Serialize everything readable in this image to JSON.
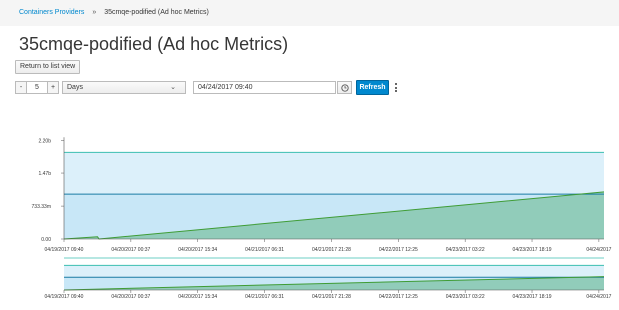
{
  "breadcrumb": {
    "parent": "Containers Providers",
    "separator": "»",
    "current": "35cmqe-podified (Ad hoc Metrics)"
  },
  "page": {
    "title": "35cmqe-podified (Ad hoc Metrics)"
  },
  "toolbar": {
    "return_label": "Return to list view",
    "stepper_minus": "-",
    "stepper_value": "5",
    "stepper_plus": "+",
    "unit_value": "Days",
    "date_value": "04/24/2017 09:40",
    "refresh_label": "Refresh",
    "clock_icon": "clock-icon",
    "kebab_icon": "kebab-icon",
    "chevron_icon": "chevron-down-icon"
  },
  "colors": {
    "accent": "#0088ce",
    "area_fill": "#bfe3f5",
    "upper_line": "#3dbfb0",
    "mid_line": "#1a7ba4",
    "series_line": "#3f9c35",
    "series_fill": "#8bc9b2"
  },
  "chart_data": [
    {
      "type": "area",
      "y_ticks": [
        "2.20b",
        "1.47b",
        "733.33m",
        "0.00"
      ],
      "y_tick_values": [
        2.2,
        1.47,
        0.73333,
        0
      ],
      "ylim": [
        0,
        2.2
      ],
      "x_ticks": [
        "04/19/2017 09:40",
        "04/20/2017 00:37",
        "04/20/2017 15:34",
        "04/21/2017 06:31",
        "04/21/2017 21:28",
        "04/22/2017 12:25",
        "04/23/2017 03:22",
        "04/23/2017 18:19",
        "04/24/2017"
      ],
      "series": [
        {
          "values": [
            [
              0,
              1.93
            ],
            [
              1,
              1.93
            ]
          ]
        },
        {
          "values": [
            [
              0,
              1.0
            ],
            [
              1,
              1.0
            ]
          ]
        },
        {
          "values": [
            [
              0,
              0.0
            ],
            [
              0.062,
              0.05
            ],
            [
              0.065,
              0.0
            ],
            [
              1,
              1.05
            ]
          ]
        }
      ],
      "grid": false,
      "legend": "none"
    },
    {
      "type": "area",
      "x_ticks": [
        "04/19/2017 09:40",
        "04/20/2017 00:37",
        "04/20/2017 15:34",
        "04/21/2017 06:31",
        "04/21/2017 21:28",
        "04/22/2017 12:25",
        "04/23/2017 03:22",
        "04/23/2017 18:19",
        "04/24/2017"
      ],
      "series": [
        {
          "values": [
            [
              0,
              1.93
            ],
            [
              1,
              1.93
            ]
          ]
        },
        {
          "values": [
            [
              0,
              1.0
            ],
            [
              1,
              1.0
            ]
          ]
        },
        {
          "values": [
            [
              0,
              0.0
            ],
            [
              1,
              1.05
            ]
          ]
        }
      ],
      "legend": "none"
    }
  ]
}
